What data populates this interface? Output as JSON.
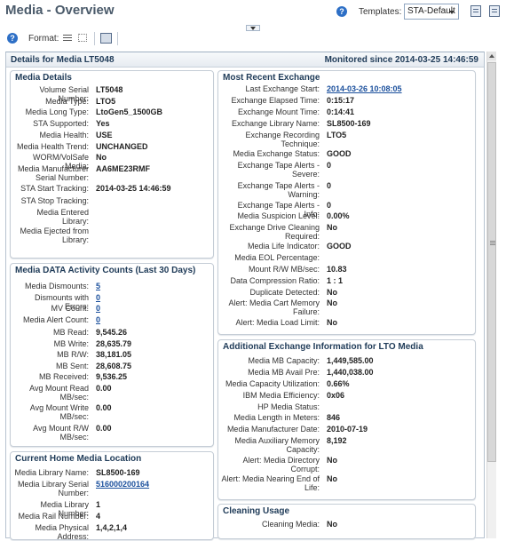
{
  "page": {
    "title": "Media - Overview"
  },
  "templates": {
    "label": "Templates:",
    "selected": "STA-Default"
  },
  "toolbar": {
    "format_label": "Format:"
  },
  "outer": {
    "title": "Details for Media LT5048",
    "monitored": "Monitored since 2014-03-25 14:46:59"
  },
  "media_details": {
    "title": "Media Details",
    "rows": [
      {
        "label": "Volume Serial Number:",
        "value": "LT5048"
      },
      {
        "label": "Media Type:",
        "value": "LTO5"
      },
      {
        "label": "Media Long Type:",
        "value": "LtoGen5_1500GB"
      },
      {
        "label": "STA Supported:",
        "value": "Yes"
      },
      {
        "label": "Media Health:",
        "value": "USE"
      },
      {
        "label": "Media Health Trend:",
        "value": "UNCHANGED"
      },
      {
        "label": "WORM/VolSafe Media:",
        "value": "No"
      },
      {
        "label": "Media Manufacturer Serial Number:",
        "value": "AA6ME23RMF"
      },
      {
        "label": "STA Start Tracking:",
        "value": "2014-03-25 14:46:59"
      },
      {
        "label": "STA Stop Tracking:",
        "value": ""
      },
      {
        "label": "Media Entered Library:",
        "value": ""
      },
      {
        "label": "Media Ejected from Library:",
        "value": ""
      }
    ]
  },
  "activity": {
    "title": "Media DATA Activity Counts (Last 30 Days)",
    "rows": [
      {
        "label": "Media Dismounts:",
        "value": "5"
      },
      {
        "label": "Dismounts with Errors:",
        "value": "0"
      },
      {
        "label": "MV Count:",
        "value": "0"
      },
      {
        "label": "Media Alert Count:",
        "value": "0"
      },
      {
        "label": "MB Read:",
        "value": "9,545.26"
      },
      {
        "label": "MB Write:",
        "value": "28,635.79"
      },
      {
        "label": "MB R/W:",
        "value": "38,181.05"
      },
      {
        "label": "MB Sent:",
        "value": "28,608.75"
      },
      {
        "label": "MB Received:",
        "value": "9,536.25"
      },
      {
        "label": "Avg Mount Read MB/sec:",
        "value": "0.00"
      },
      {
        "label": "Avg Mount Write MB/sec:",
        "value": "0.00"
      },
      {
        "label": "Avg Mount R/W MB/sec:",
        "value": "0.00"
      }
    ]
  },
  "home_location": {
    "title": "Current Home Media Location",
    "rows": [
      {
        "label": "Media Library Name:",
        "value": "SL8500-169"
      },
      {
        "label": "Media Library Serial Number:",
        "value": "516000200164"
      },
      {
        "label": "Media Library Number:",
        "value": "1"
      },
      {
        "label": "Media Rail Number:",
        "value": "4"
      },
      {
        "label": "Media Physical Address:",
        "value": "1,4,2,1,4"
      }
    ]
  },
  "recent_exchange": {
    "title": "Most Recent Exchange",
    "rows": [
      {
        "label": "Last Exchange Start:",
        "value": "2014-03-26 10:08:05"
      },
      {
        "label": "Exchange Elapsed Time:",
        "value": "0:15:17"
      },
      {
        "label": "Exchange Mount Time:",
        "value": "0:14:41"
      },
      {
        "label": "Exchange Library Name:",
        "value": "SL8500-169"
      },
      {
        "label": "Exchange Recording Technique:",
        "value": "LTO5"
      },
      {
        "label": "Media Exchange Status:",
        "value": "GOOD"
      },
      {
        "label": "Exchange Tape Alerts - Severe:",
        "value": "0"
      },
      {
        "label": "Exchange Tape Alerts - Warning:",
        "value": "0"
      },
      {
        "label": "Exchange Tape Alerts - Info:",
        "value": "0"
      },
      {
        "label": "Media Suspicion Level:",
        "value": "0.00%"
      },
      {
        "label": "Exchange Drive Cleaning Required:",
        "value": "No"
      },
      {
        "label": "Media Life Indicator:",
        "value": "GOOD"
      },
      {
        "label": "Media EOL Percentage:",
        "value": ""
      },
      {
        "label": "Mount R/W MB/sec:",
        "value": "10.83"
      },
      {
        "label": "Data Compression Ratio:",
        "value": "1 : 1"
      },
      {
        "label": "Duplicate Detected:",
        "value": "No"
      },
      {
        "label": "Alert: Media Cart Memory Failure:",
        "value": "No"
      },
      {
        "label": "Alert: Media Load Limit:",
        "value": "No"
      }
    ]
  },
  "additional": {
    "title": "Additional Exchange Information for LTO Media",
    "rows": [
      {
        "label": "Media MB Capacity:",
        "value": "1,449,585.00"
      },
      {
        "label": "Media MB Avail Pre:",
        "value": "1,440,038.00"
      },
      {
        "label": "Media Capacity Utilization:",
        "value": "0.66%"
      },
      {
        "label": "IBM Media Efficiency:",
        "value": "0x06"
      },
      {
        "label": "HP Media Status:",
        "value": ""
      },
      {
        "label": "Media Length in Meters:",
        "value": "846"
      },
      {
        "label": "Media Manufacturer Date:",
        "value": "2010-07-19"
      },
      {
        "label": "Media Auxiliary Memory Capacity:",
        "value": "8,192"
      },
      {
        "label": "Alert: Media Directory Corrupt:",
        "value": "No"
      },
      {
        "label": "Alert: Media Nearing End of Life:",
        "value": "No"
      }
    ]
  },
  "cleaning": {
    "title": "Cleaning Usage",
    "rows": [
      {
        "label": "Cleaning Media:",
        "value": "No"
      }
    ]
  }
}
